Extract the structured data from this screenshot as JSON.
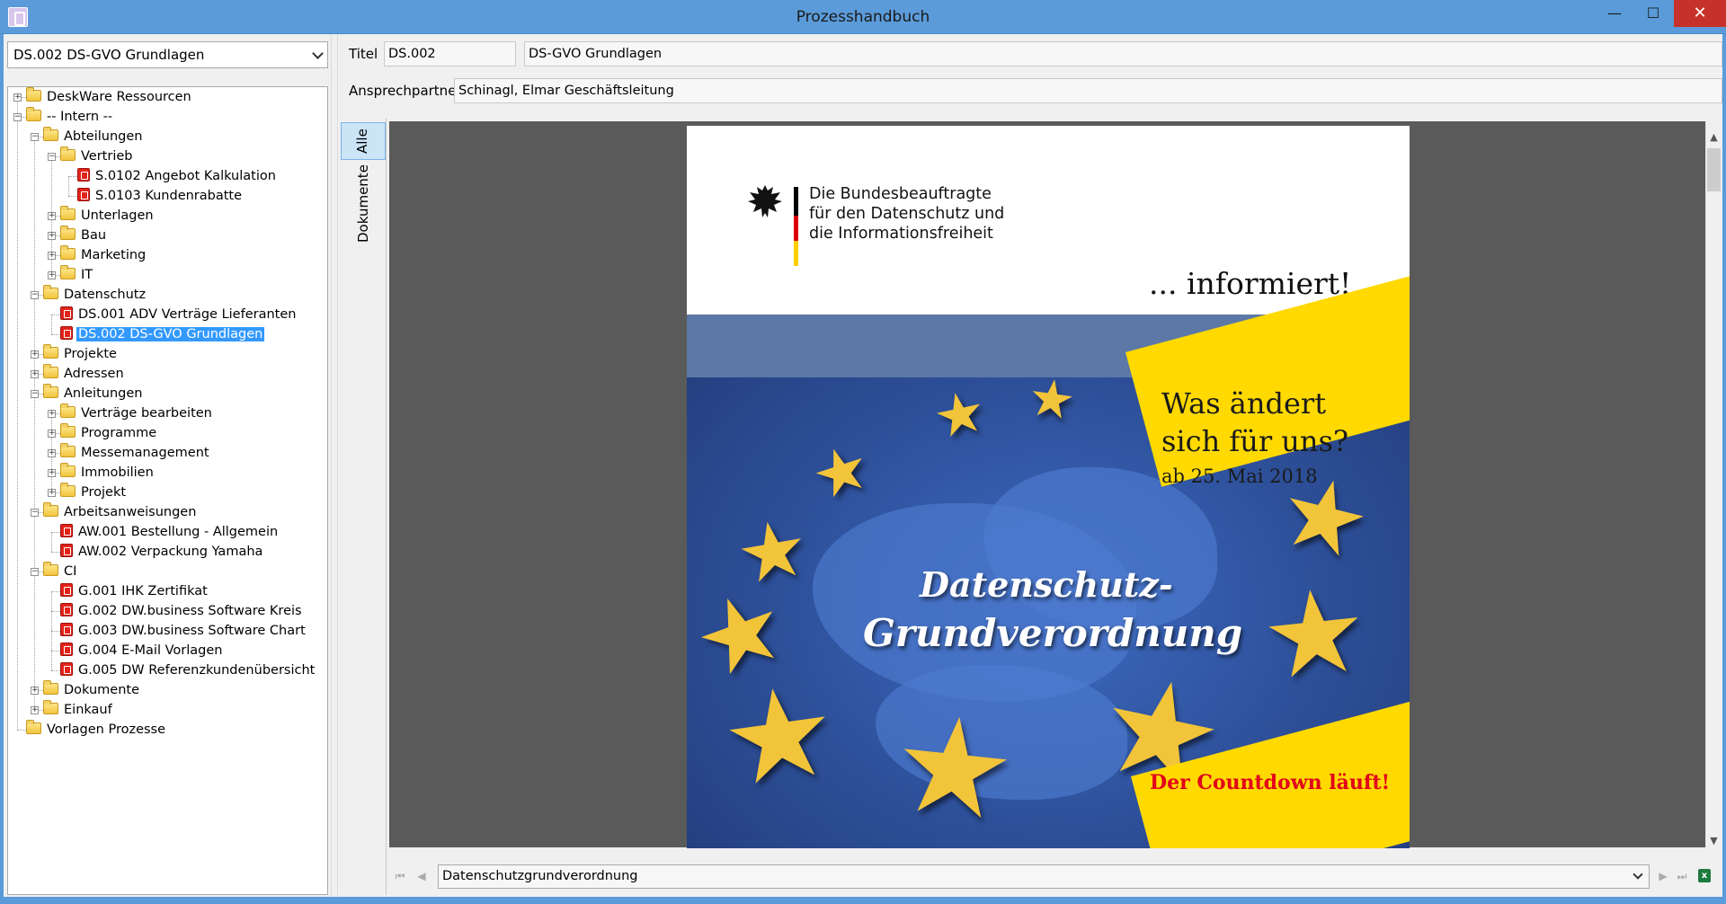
{
  "window": {
    "title": "Prozesshandbuch",
    "minimize_symbol": "—",
    "maximize_symbol": "☐",
    "close_symbol": "✕"
  },
  "process_select": {
    "value": "DS.002 DS-GVO Grundlagen"
  },
  "tree": [
    {
      "label": "DeskWare Ressourcen",
      "level": 0,
      "type": "folder",
      "expander": "+"
    },
    {
      "label": "-- Intern --",
      "level": 0,
      "type": "folder",
      "expander": "−"
    },
    {
      "label": "Abteilungen",
      "level": 1,
      "type": "folder",
      "expander": "−"
    },
    {
      "label": "Vertrieb",
      "level": 2,
      "type": "folder",
      "expander": "−"
    },
    {
      "label": "S.0102 Angebot Kalkulation",
      "level": 3,
      "type": "doc",
      "expander": ""
    },
    {
      "label": "S.0103 Kundenrabatte",
      "level": 3,
      "type": "doc",
      "expander": ""
    },
    {
      "label": "Unterlagen",
      "level": 2,
      "type": "folder",
      "expander": "+"
    },
    {
      "label": "Bau",
      "level": 2,
      "type": "folder",
      "expander": "+"
    },
    {
      "label": "Marketing",
      "level": 2,
      "type": "folder",
      "expander": "+"
    },
    {
      "label": "IT",
      "level": 2,
      "type": "folder",
      "expander": "+"
    },
    {
      "label": "Datenschutz",
      "level": 1,
      "type": "folder",
      "expander": "−"
    },
    {
      "label": "DS.001 ADV Verträge Lieferanten",
      "level": 2,
      "type": "doc",
      "expander": ""
    },
    {
      "label": "DS.002 DS-GVO Grundlagen",
      "level": 2,
      "type": "doc",
      "expander": "",
      "selected": true
    },
    {
      "label": "Projekte",
      "level": 1,
      "type": "folder",
      "expander": "+"
    },
    {
      "label": "Adressen",
      "level": 1,
      "type": "folder",
      "expander": "+"
    },
    {
      "label": "Anleitungen",
      "level": 1,
      "type": "folder",
      "expander": "−"
    },
    {
      "label": "Verträge bearbeiten",
      "level": 2,
      "type": "folder",
      "expander": "+"
    },
    {
      "label": "Programme",
      "level": 2,
      "type": "folder",
      "expander": "+"
    },
    {
      "label": "Messemanagement",
      "level": 2,
      "type": "folder",
      "expander": "+"
    },
    {
      "label": "Immobilien",
      "level": 2,
      "type": "folder",
      "expander": "+"
    },
    {
      "label": "Projekt",
      "level": 2,
      "type": "folder",
      "expander": "+"
    },
    {
      "label": "Arbeitsanweisungen",
      "level": 1,
      "type": "folder",
      "expander": "−"
    },
    {
      "label": "AW.001 Bestellung - Allgemein",
      "level": 2,
      "type": "doc",
      "expander": ""
    },
    {
      "label": "AW.002 Verpackung Yamaha",
      "level": 2,
      "type": "doc",
      "expander": ""
    },
    {
      "label": "CI",
      "level": 1,
      "type": "folder",
      "expander": "−"
    },
    {
      "label": "G.001 IHK Zertifikat",
      "level": 2,
      "type": "doc",
      "expander": ""
    },
    {
      "label": "G.002 DW.business Software Kreis",
      "level": 2,
      "type": "doc",
      "expander": ""
    },
    {
      "label": "G.003 DW.business Software Chart",
      "level": 2,
      "type": "doc",
      "expander": ""
    },
    {
      "label": "G.004 E-Mail Vorlagen",
      "level": 2,
      "type": "doc",
      "expander": ""
    },
    {
      "label": "G.005 DW Referenzkundenübersicht",
      "level": 2,
      "type": "doc",
      "expander": ""
    },
    {
      "label": "Dokumente",
      "level": 1,
      "type": "folder",
      "expander": "+"
    },
    {
      "label": "Einkauf",
      "level": 1,
      "type": "folder",
      "expander": "+"
    },
    {
      "label": "Vorlagen Prozesse",
      "level": 0,
      "type": "folder",
      "expander": ""
    }
  ],
  "header": {
    "titel_label": "Titel",
    "titel_code": "DS.002",
    "titel_name": "DS-GVO Grundlagen",
    "contact_label": "Ansprechpartner",
    "contact_value": "Schinagl, Elmar Geschäftsleitung"
  },
  "tabs": {
    "all": "Alle",
    "documents": "Dokumente"
  },
  "scroll": {
    "up": "▲",
    "down": "▼"
  },
  "document_page": {
    "authority_line1": "Die Bundesbeauftragte",
    "authority_line2": "für den Datenschutz und",
    "authority_line3": "die Informationsfreiheit",
    "tagline": "... informiert!",
    "question_line1": "Was ändert",
    "question_line2": "sich für uns?",
    "date_line": "ab 25. Mai 2018",
    "headline_line1": "Datenschutz-",
    "headline_line2": "Grundverordnung",
    "countdown": "Der Countdown läuft!"
  },
  "bottom_nav": {
    "document_select": "Datenschutzgrundverordnung",
    "first": "⏮",
    "prev": "◀",
    "next": "▶",
    "last": "⏭",
    "export_icon_letter": "x"
  },
  "colors": {
    "titlebar": "#5b9bd9",
    "selection": "#3399ff",
    "close": "#c7312b",
    "flyer_yellow": "#ffd900",
    "flyer_blue": "#2d4f98"
  }
}
